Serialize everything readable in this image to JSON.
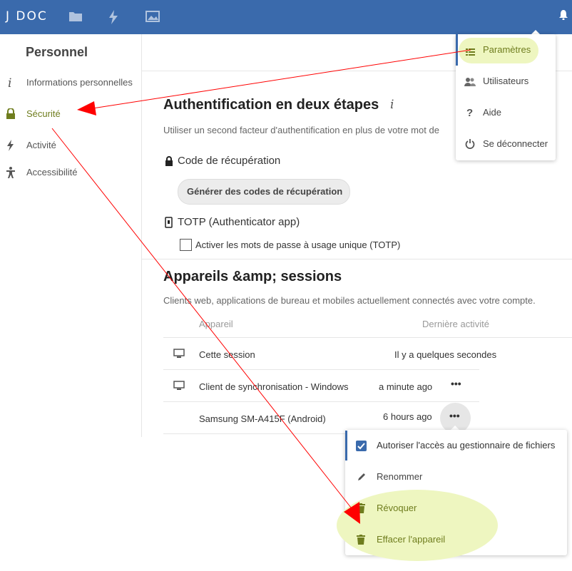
{
  "app": {
    "logo": "J DOC"
  },
  "topbar_icons": [
    "files-folder-icon",
    "activity-lightning-icon",
    "photos-image-icon",
    "notifications-bell-icon"
  ],
  "sidebar": {
    "title": "Personnel",
    "items": [
      {
        "label": "Informations personnelles",
        "icon": "info-icon"
      },
      {
        "label": "Sécurité",
        "icon": "lock-icon",
        "active": true
      },
      {
        "label": "Activité",
        "icon": "lightning-icon"
      },
      {
        "label": "Accessibilité",
        "icon": "person-accessibility-icon"
      }
    ]
  },
  "twofactor": {
    "title": "Authentification en deux étapes",
    "description": "Utiliser un second facteur d'authentification en plus de votre mot de",
    "recovery_title": "Code de récupération",
    "recovery_button": "Générer des codes de récupération",
    "totp_title": "TOTP (Authenticator app)",
    "totp_checkbox": "Activer les mots de passe à usage unique (TOTP)"
  },
  "devices": {
    "title": "Appareils &amp; sessions",
    "description": "Clients web, applications de bureau et mobiles actuellement connectés avec votre compte.",
    "col_device": "Appareil",
    "col_activity": "Dernière activité",
    "rows": [
      {
        "name": "Cette session",
        "activity": "Il y a quelques secondes"
      },
      {
        "name": "Client de synchronisation - Windows",
        "activity": "a minute ago"
      },
      {
        "name": "Samsung SM-A415F (Android)",
        "activity": "6 hours ago"
      }
    ]
  },
  "settings_menu": [
    {
      "label": "Paramètres",
      "icon": "settings-list-icon"
    },
    {
      "label": "Utilisateurs",
      "icon": "users-icon"
    },
    {
      "label": "Aide",
      "icon": "help-icon"
    },
    {
      "label": "Se déconnecter",
      "icon": "power-icon"
    }
  ],
  "device_menu": [
    {
      "label": "Autoriser l'accès au gestionnaire de fichiers",
      "icon": "checkbox-checked-icon"
    },
    {
      "label": "Renommer",
      "icon": "pencil-icon"
    },
    {
      "label": "Révoquer",
      "icon": "trash-icon"
    },
    {
      "label": "Effacer l'appareil",
      "icon": "trash-icon"
    }
  ],
  "colors": {
    "topbar": "#3a6aac",
    "highlight": "#eef6c0",
    "annotation_red": "#ff0000",
    "accent_text": "#6f7d1e"
  }
}
